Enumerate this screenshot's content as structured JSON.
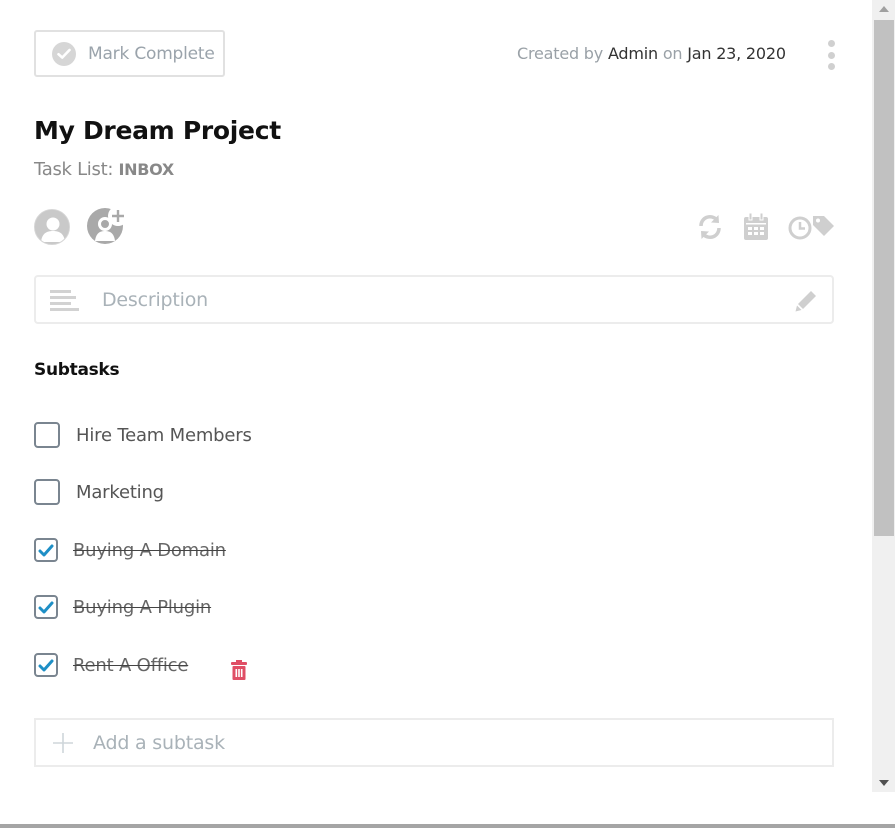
{
  "header": {
    "mark_complete_label": "Mark Complete",
    "created_prefix": "Created by",
    "created_by": "Admin",
    "created_on_word": "on",
    "created_date": "Jan 23, 2020"
  },
  "task": {
    "title": "My Dream Project",
    "task_list_label": "Task List:",
    "task_list_value": "INBOX"
  },
  "toolbar_icons": [
    "repeat-icon",
    "calendar-icon",
    "clock-icon",
    "tag-icon"
  ],
  "description": {
    "placeholder": "Description"
  },
  "subtasks": {
    "title": "Subtasks",
    "items": [
      {
        "label": "Hire Team Members",
        "done": false
      },
      {
        "label": "Marketing",
        "done": false
      },
      {
        "label": "Buying A Domain",
        "done": true
      },
      {
        "label": "Buying A Plugin",
        "done": true
      },
      {
        "label": "Rent A Office",
        "done": true
      }
    ],
    "add_placeholder": "Add a subtask"
  },
  "colors": {
    "check_accent": "#1e8fc6",
    "delete_accent": "#e04e65",
    "muted_icon": "#cfcfcf"
  }
}
